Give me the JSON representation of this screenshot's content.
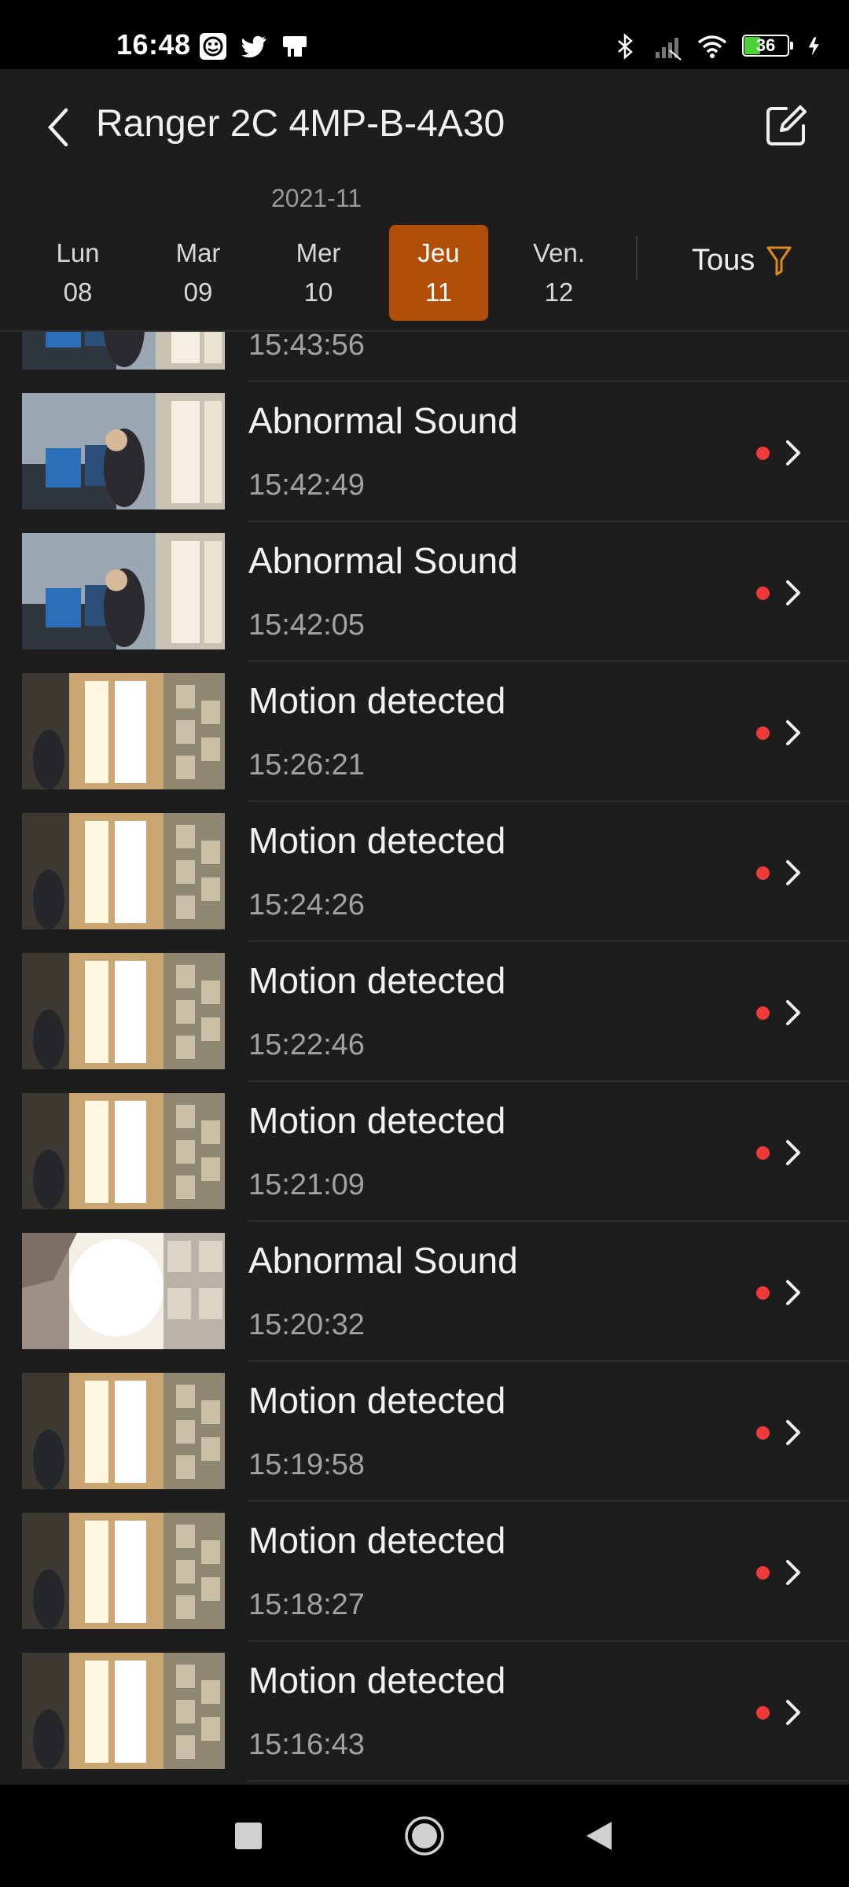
{
  "status_bar": {
    "time": "16:48",
    "battery": "36",
    "left_icons": [
      "face-icon",
      "twitter-icon",
      "device-icon"
    ],
    "right_icons": [
      "bluetooth-icon",
      "signal-icon",
      "wifi-icon",
      "battery-icon",
      "charging-icon"
    ]
  },
  "header": {
    "title": "Ranger 2C 4MP-B-4A30",
    "month": "2021-11",
    "days": [
      {
        "name": "Lun",
        "num": "08",
        "selected": false
      },
      {
        "name": "Mar",
        "num": "09",
        "selected": false
      },
      {
        "name": "Mer",
        "num": "10",
        "selected": false
      },
      {
        "name": "Jeu",
        "num": "11",
        "selected": true
      },
      {
        "name": "Ven.",
        "num": "12",
        "selected": false
      }
    ],
    "filter_label": "Tous",
    "accent_color": "#b14e07",
    "filter_icon_color": "#e08a1e"
  },
  "events": [
    {
      "label": "",
      "time": "15:43:56",
      "thumb": "office"
    },
    {
      "label": "Abnormal Sound",
      "time": "15:42:49",
      "thumb": "office"
    },
    {
      "label": "Abnormal Sound",
      "time": "15:42:05",
      "thumb": "office"
    },
    {
      "label": "Motion detected",
      "time": "15:26:21",
      "thumb": "window"
    },
    {
      "label": "Motion detected",
      "time": "15:24:26",
      "thumb": "window"
    },
    {
      "label": "Motion detected",
      "time": "15:22:46",
      "thumb": "window"
    },
    {
      "label": "Motion detected",
      "time": "15:21:09",
      "thumb": "window"
    },
    {
      "label": "Abnormal Sound",
      "time": "15:20:32",
      "thumb": "bright"
    },
    {
      "label": "Motion detected",
      "time": "15:19:58",
      "thumb": "window"
    },
    {
      "label": "Motion detected",
      "time": "15:18:27",
      "thumb": "window"
    },
    {
      "label": "Motion detected",
      "time": "15:16:43",
      "thumb": "window"
    }
  ],
  "unread_dot_color": "#f03a3a",
  "nav": [
    "recents-square-icon",
    "home-circle-icon",
    "back-triangle-icon"
  ]
}
